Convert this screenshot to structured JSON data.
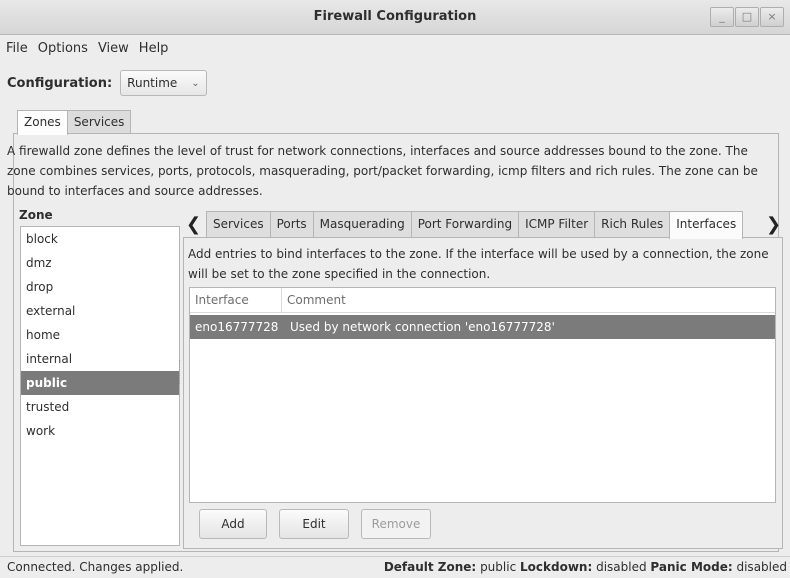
{
  "window": {
    "title": "Firewall Configuration",
    "controls": [
      "_",
      "□",
      "×"
    ]
  },
  "menu": [
    "File",
    "Options",
    "View",
    "Help"
  ],
  "configuration": {
    "label": "Configuration:",
    "value": "Runtime"
  },
  "main_tabs": [
    {
      "label": "Zones",
      "active": true
    },
    {
      "label": "Services",
      "active": false
    }
  ],
  "description": "A firewalld zone defines the level of trust for network connections, interfaces and source addresses bound to the zone. The zone combines services, ports, protocols, masquerading, port/packet forwarding, icmp filters and rich rules. The zone can be bound to interfaces and source addresses.",
  "zones": {
    "header": "Zone",
    "items": [
      "block",
      "dmz",
      "drop",
      "external",
      "home",
      "internal",
      "public",
      "trusted",
      "work"
    ],
    "selected": "public"
  },
  "sub_tabs": [
    {
      "label": "Services",
      "active": false
    },
    {
      "label": "Ports",
      "active": false
    },
    {
      "label": "Masquerading",
      "active": false
    },
    {
      "label": "Port Forwarding",
      "active": false
    },
    {
      "label": "ICMP Filter",
      "active": false
    },
    {
      "label": "Rich Rules",
      "active": false
    },
    {
      "label": "Interfaces",
      "active": true
    }
  ],
  "interfaces": {
    "description": "Add entries to bind interfaces to the zone. If the interface will be used by a connection, the zone will be set to the zone specified in the connection.",
    "columns": [
      "Interface",
      "Comment"
    ],
    "rows": [
      {
        "interface": "eno16777728",
        "comment": "Used by network connection 'eno16777728'",
        "selected": true
      }
    ],
    "buttons": {
      "add": "Add",
      "edit": "Edit",
      "remove": "Remove"
    }
  },
  "status": {
    "left": "Connected.  Changes applied.",
    "default_zone_label": "Default Zone:",
    "default_zone_value": "public",
    "lockdown_label": "Lockdown:",
    "lockdown_value": "disabled",
    "panic_label": "Panic Mode:",
    "panic_value": "disabled"
  }
}
